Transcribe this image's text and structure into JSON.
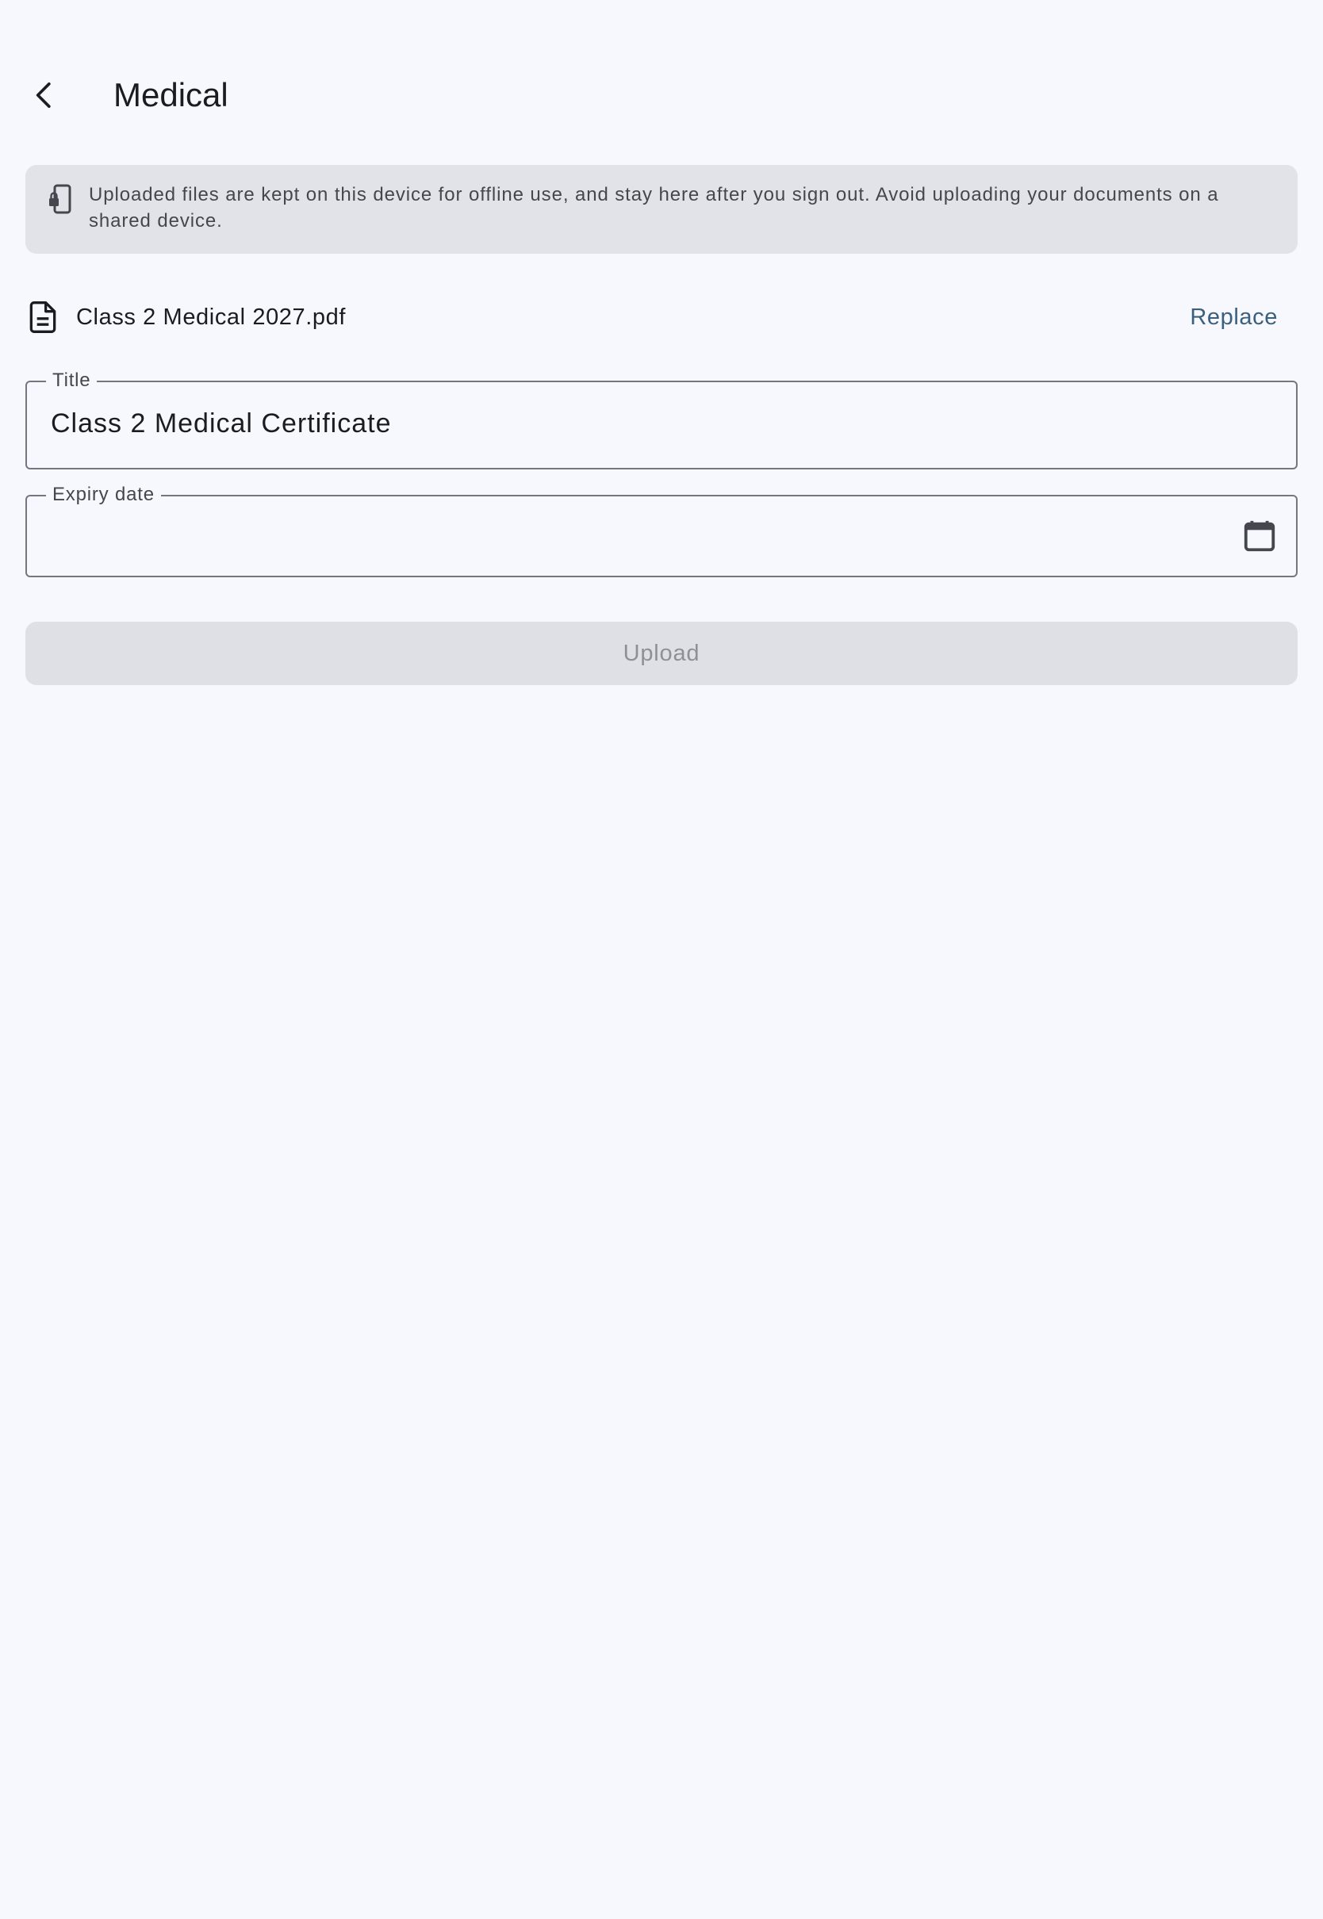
{
  "app_bar": {
    "back_icon": "chevron-left-icon",
    "title": "Medical"
  },
  "info_banner": {
    "icon": "phone-lock-icon",
    "text": "Uploaded files are kept on this device for offline use, and stay here after you sign out. Avoid uploading your documents on a shared device."
  },
  "file": {
    "icon": "document-icon",
    "name": "Class 2 Medical 2027.pdf",
    "replace_label": "Replace"
  },
  "form": {
    "title_label": "Title",
    "title_value": "Class 2 Medical Certificate",
    "expiry_label": "Expiry date",
    "expiry_value": "",
    "calendar_icon": "calendar-icon"
  },
  "upload": {
    "label": "Upload",
    "enabled": false
  },
  "colors": {
    "background": "#f7f8fd",
    "banner": "#e2e3e8",
    "accent": "#3b5f7c",
    "disabled_button": "#dfe0e5",
    "disabled_text": "#8e9097",
    "outline": "#74777f"
  }
}
